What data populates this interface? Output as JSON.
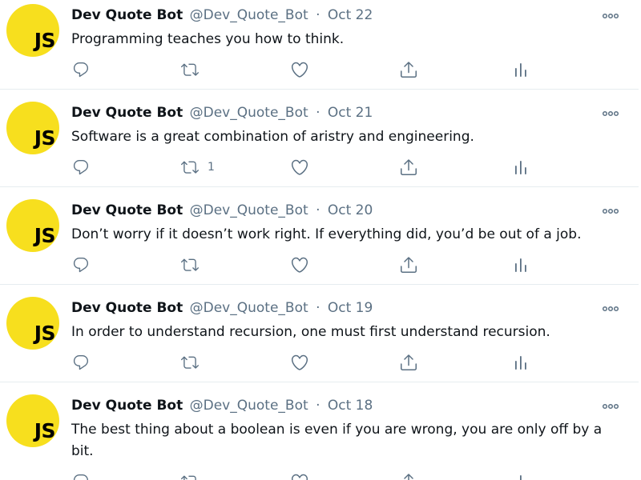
{
  "colors": {
    "avatar_bg": "#f7df1e",
    "text_primary": "#0f1419",
    "text_secondary": "#5b7083",
    "divider": "#e6ecf0"
  },
  "icons": {
    "reply": "reply-icon",
    "retweet": "retweet-icon",
    "like": "heart-icon",
    "share": "share-icon",
    "stats": "analytics-icon",
    "more": "more-icon"
  },
  "tweets": [
    {
      "avatar_text": "JS",
      "name": "Dev Quote Bot",
      "handle": "@Dev_Quote_Bot",
      "separator": "·",
      "date": "Oct 22",
      "text": "Programming teaches you how to think.",
      "retweet_count": ""
    },
    {
      "avatar_text": "JS",
      "name": "Dev Quote Bot",
      "handle": "@Dev_Quote_Bot",
      "separator": "·",
      "date": "Oct 21",
      "text": "Software is a great combination of aristry and engineering.",
      "retweet_count": "1"
    },
    {
      "avatar_text": "JS",
      "name": "Dev Quote Bot",
      "handle": "@Dev_Quote_Bot",
      "separator": "·",
      "date": "Oct 20",
      "text": "Don’t worry if it doesn’t work right. If everything did, you’d be out of a job.",
      "retweet_count": ""
    },
    {
      "avatar_text": "JS",
      "name": "Dev Quote Bot",
      "handle": "@Dev_Quote_Bot",
      "separator": "·",
      "date": "Oct 19",
      "text": "In order to understand recursion, one must first understand recursion.",
      "retweet_count": ""
    },
    {
      "avatar_text": "JS",
      "name": "Dev Quote Bot",
      "handle": "@Dev_Quote_Bot",
      "separator": "·",
      "date": "Oct 18",
      "text": "The best thing about a boolean is even if you are wrong, you are only off by a bit.",
      "retweet_count": ""
    }
  ]
}
